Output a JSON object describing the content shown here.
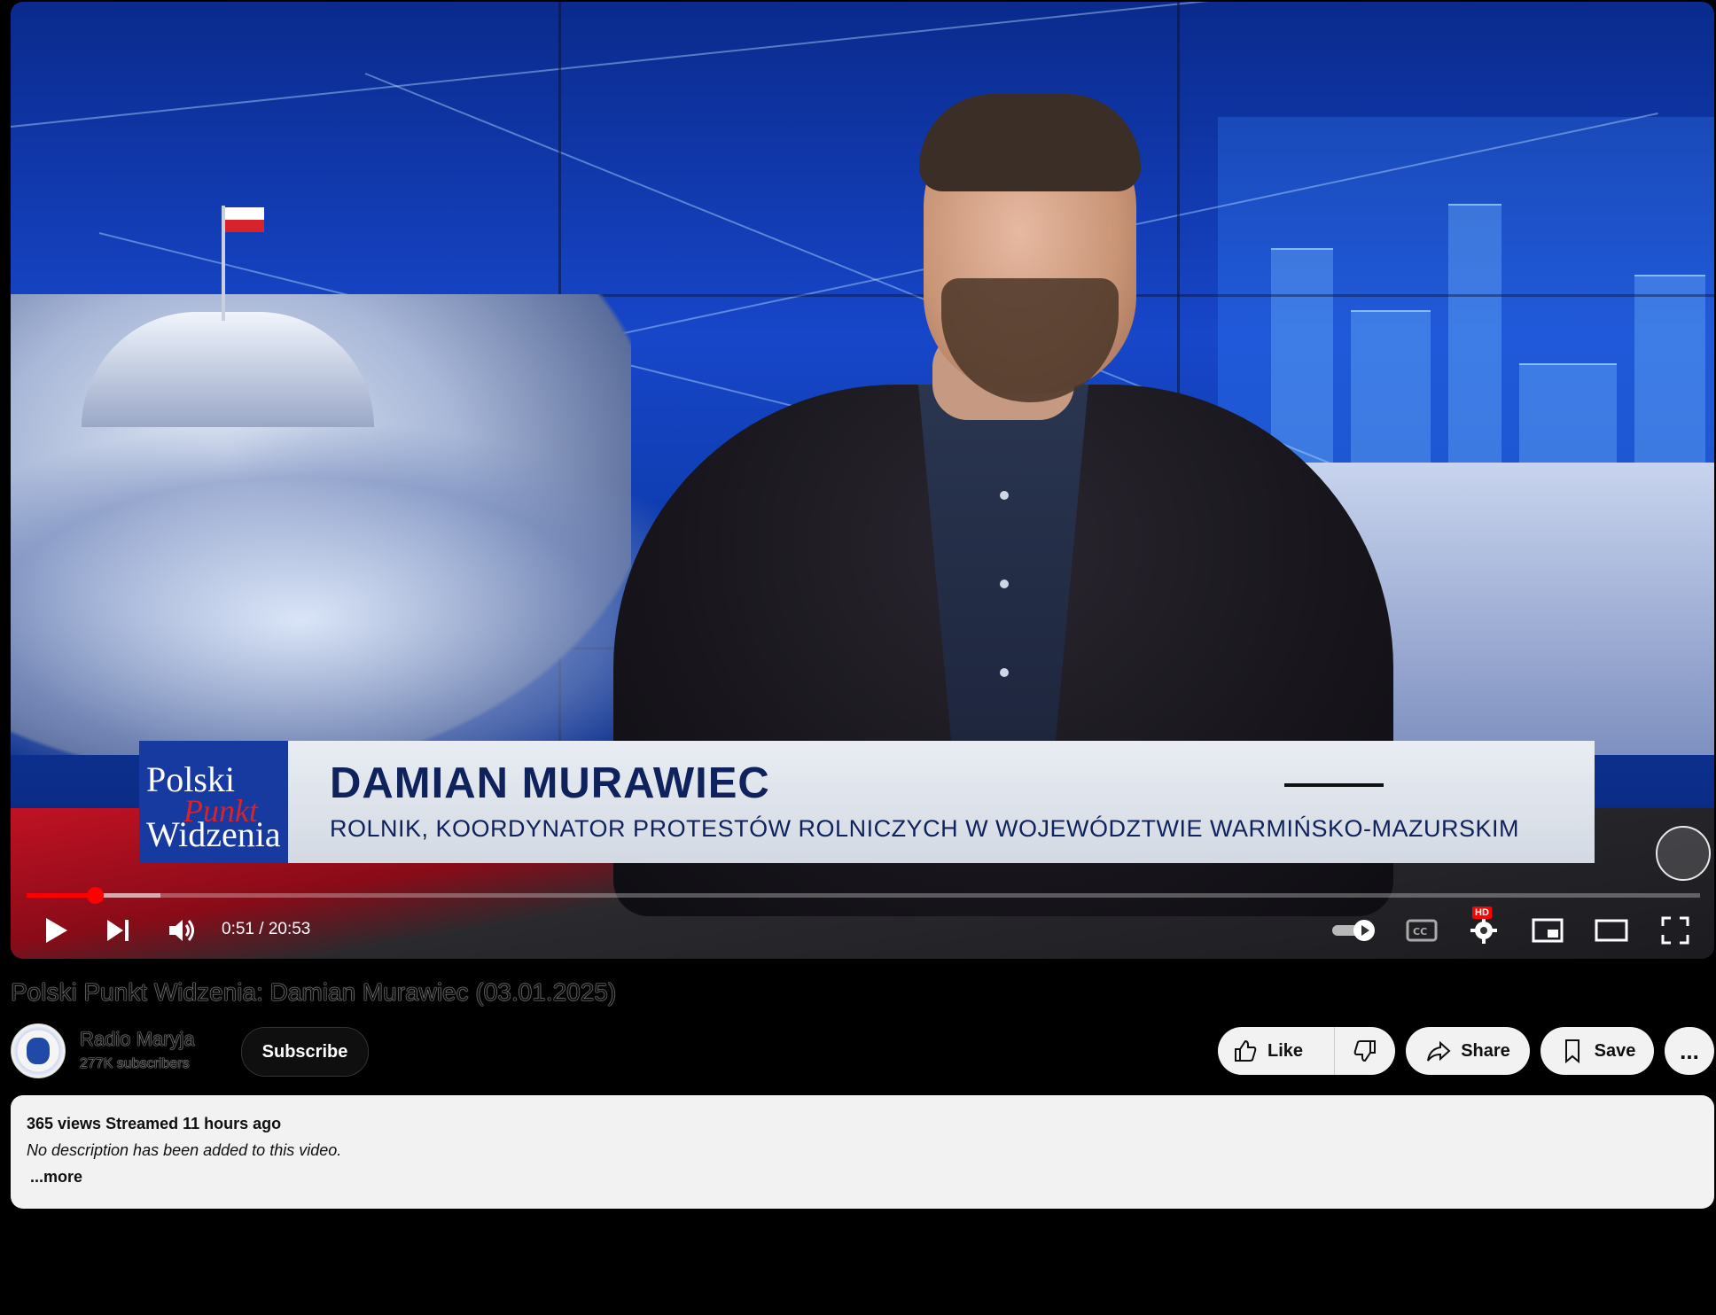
{
  "video": {
    "lower_third_logo_line1": "Polski",
    "lower_third_logo_line2": "Punkt",
    "lower_third_logo_line3": "Widzenia",
    "lower_third_name": "DAMIAN MURAWIEC",
    "lower_third_role": "ROLNIK, KOORDYNATOR PROTESTÓW ROLNICZYCH W WOJEWÓDZTWIE WARMIŃSKO-MAZURSKIM",
    "progress_played_fraction": 0.0407,
    "progress_buffered_fraction": 0.08,
    "time_display": "0:51 / 20:53",
    "hd_badge": "HD",
    "accent_color": "#ff0000"
  },
  "controls": {
    "play_icon": "play-icon",
    "next_icon": "skip-next-icon",
    "volume_icon": "volume-icon",
    "autoplay_icon": "autoplay-toggle-icon",
    "cc_icon": "cc-icon",
    "settings_icon": "gear-icon",
    "miniplayer_icon": "miniplayer-icon",
    "theater_icon": "theater-mode-icon",
    "fullscreen_icon": "fullscreen-icon"
  },
  "meta": {
    "title": "Polski Punkt Widzenia: Damian Murawiec (03.01.2025)",
    "channel_name": "Radio Maryja",
    "subscribers": "277K subscribers",
    "subscribe_label": "Subscribe",
    "like_label": "Like",
    "share_label": "Share",
    "save_label": "Save",
    "more_label": "...",
    "views_line": "365 views  Streamed 11 hours ago",
    "description": "No description has been added to this video.",
    "more_link": "...more"
  }
}
